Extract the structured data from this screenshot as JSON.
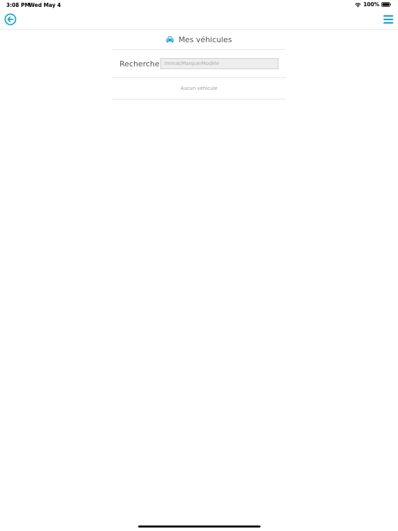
{
  "status_bar": {
    "time": "3:08 PM",
    "date": "Wed May 4",
    "battery": "100%"
  },
  "nav": {
    "back_icon": "arrow-left-circle-icon",
    "menu_icon": "hamburger-menu-icon"
  },
  "header": {
    "icon": "car-icon",
    "title": "Mes véhicules"
  },
  "search": {
    "label": "Recherche",
    "value": "",
    "placeholder": "Immat/Marque/Modèle"
  },
  "vehicles": {
    "empty_message": "Aucun véhicule"
  },
  "colors": {
    "accent": "#1aa3d9"
  }
}
